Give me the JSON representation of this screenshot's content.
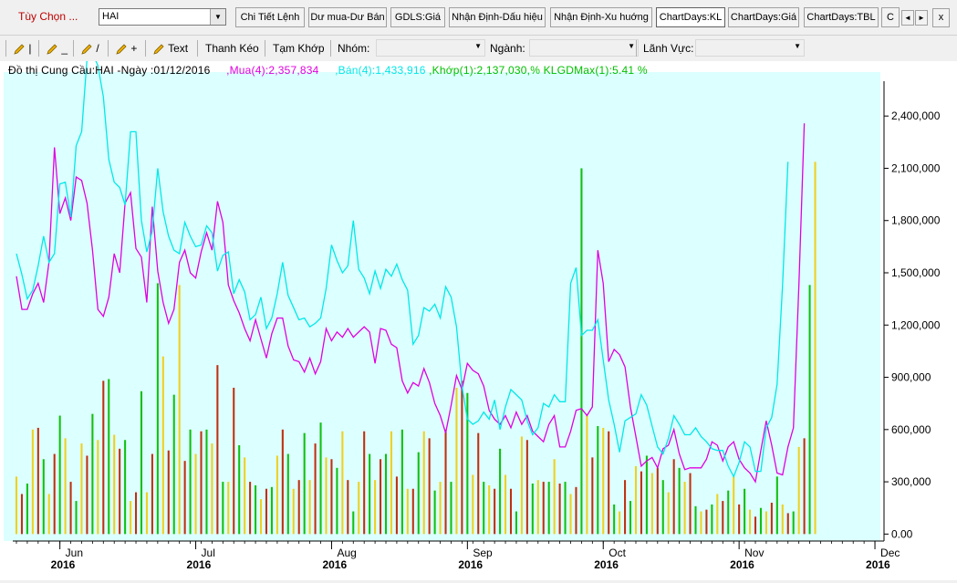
{
  "toolbar": {
    "options_label": "Tùy Chọn ...",
    "symbol": "HAI",
    "tabs": [
      {
        "label": "Chi Tiết Lệnh",
        "active": false
      },
      {
        "label": "Dư mua-Dư Bán",
        "active": false
      },
      {
        "label": "GDLS:Giá",
        "active": false
      },
      {
        "label": "Nhận Định-Dấu hiệu",
        "active": false
      },
      {
        "label": "Nhận Định-Xu huớng",
        "active": false
      },
      {
        "label": "ChartDays:KL",
        "active": true
      },
      {
        "label": "ChartDays:Giá",
        "active": false
      },
      {
        "label": "ChartDays:TBL",
        "active": false
      },
      {
        "label": "C",
        "active": false
      }
    ],
    "nav_prev": "◄",
    "nav_next": "►",
    "close": "x"
  },
  "drawbar": {
    "tools": [
      "|",
      "_",
      "/",
      "+",
      "Text"
    ],
    "drag_label": "Thanh Kéo",
    "pause_label": "Tạm Khớp",
    "group_label": "Nhóm:",
    "industry_label": "Ngành:",
    "field_label": "Lãnh Vực:"
  },
  "legend": {
    "title": "Đồ thị Cung Cầu:HAI -Ngày :01/12/2016",
    "buy": ",Mua(4):2,357,834",
    "sell": ",Bán(4):1,433,916",
    "match": ",Khớp(1):2,137,030,% KLGDMax(1):5.41 %",
    "colors": {
      "buy": "#e000e0",
      "sell": "#00e8e8",
      "match": "#00c000"
    }
  },
  "chart_data": {
    "type": "line",
    "ylim": [
      -40000,
      2600000
    ],
    "yticks": [
      0,
      300000,
      600000,
      900000,
      1200000,
      1500000,
      1800000,
      2100000,
      2400000
    ],
    "ytick_labels": [
      "0.00",
      "300,000",
      "600,000",
      "900,000",
      "1,200,000",
      "1,500,000",
      "1,800,000",
      "2,100,000",
      "2,400,000"
    ],
    "xticks": [
      {
        "day": 8,
        "month": "Jun",
        "year": "2016"
      },
      {
        "day": 33,
        "month": "Jul",
        "year": "2016"
      },
      {
        "day": 58,
        "month": "Aug",
        "year": "2016"
      },
      {
        "day": 83,
        "month": "Sep",
        "year": "2016"
      },
      {
        "day": 108,
        "month": "Oct",
        "year": "2016"
      },
      {
        "day": 133,
        "month": "Nov",
        "year": "2016"
      },
      {
        "day": 158,
        "month": "Dec",
        "year": "2016"
      }
    ],
    "x_count": 160,
    "series": [
      {
        "name": "Mua",
        "color": "#e000e0",
        "values": [
          1480000,
          1290000,
          1290000,
          1380000,
          1440000,
          1330000,
          1560000,
          2220000,
          1840000,
          1930000,
          1800000,
          2050000,
          2030000,
          1900000,
          1630000,
          1290000,
          1250000,
          1360000,
          1610000,
          1500000,
          1900000,
          1960000,
          1640000,
          1590000,
          1330000,
          1880000,
          1510000,
          1330000,
          1210000,
          1290000,
          1560000,
          1630000,
          1500000,
          1470000,
          1620000,
          1730000,
          1630000,
          1910000,
          1790000,
          1430000,
          1340000,
          1270000,
          1180000,
          1110000,
          1230000,
          1120000,
          1010000,
          1150000,
          1240000,
          1240000,
          1080000,
          1000000,
          990000,
          930000,
          1010000,
          920000,
          990000,
          1180000,
          1110000,
          1160000,
          1130000,
          1180000,
          1130000,
          1160000,
          1190000,
          1160000,
          980000,
          1180000,
          1170000,
          1090000,
          1070000,
          880000,
          810000,
          870000,
          850000,
          950000,
          870000,
          750000,
          680000,
          580000,
          740000,
          910000,
          830000,
          980000,
          940000,
          920000,
          850000,
          710000,
          660000,
          630000,
          680000,
          610000,
          700000,
          630000,
          680000,
          590000,
          560000,
          530000,
          630000,
          680000,
          500000,
          500000,
          590000,
          710000,
          720000,
          680000,
          730000,
          1630000,
          1440000,
          990000,
          1060000,
          1030000,
          960000,
          730000,
          560000,
          390000,
          420000,
          440000,
          380000,
          490000,
          510000,
          600000,
          460000,
          370000,
          380000,
          380000,
          380000,
          430000,
          530000,
          510000,
          420000,
          500000,
          530000,
          430000,
          380000,
          350000,
          300000,
          480000,
          650000,
          510000,
          350000,
          340000,
          500000,
          610000,
          1430000,
          2357834
        ]
      },
      {
        "name": "Bán",
        "color": "#00e8e8",
        "values": [
          1610000,
          1490000,
          1350000,
          1400000,
          1540000,
          1710000,
          1560000,
          1610000,
          2010000,
          2020000,
          1820000,
          2230000,
          2310000,
          2730000,
          2760000,
          2690000,
          2510000,
          2150000,
          2020000,
          1990000,
          1890000,
          2310000,
          2310000,
          1800000,
          1620000,
          1740000,
          2100000,
          1850000,
          1710000,
          1630000,
          1610000,
          1790000,
          1710000,
          1650000,
          1660000,
          1770000,
          1730000,
          1510000,
          1600000,
          1620000,
          1380000,
          1460000,
          1390000,
          1230000,
          1260000,
          1360000,
          1180000,
          1240000,
          1380000,
          1560000,
          1370000,
          1300000,
          1230000,
          1240000,
          1190000,
          1210000,
          1240000,
          1410000,
          1660000,
          1570000,
          1500000,
          1540000,
          1800000,
          1520000,
          1470000,
          1380000,
          1510000,
          1410000,
          1520000,
          1480000,
          1550000,
          1460000,
          1400000,
          1090000,
          1140000,
          1300000,
          1280000,
          1320000,
          1240000,
          1420000,
          1360000,
          1190000,
          850000,
          660000,
          630000,
          650000,
          700000,
          660000,
          770000,
          600000,
          730000,
          830000,
          800000,
          770000,
          650000,
          570000,
          610000,
          750000,
          730000,
          800000,
          760000,
          760000,
          1440000,
          1530000,
          1140000,
          1170000,
          1170000,
          1230000,
          1000000,
          770000,
          630000,
          470000,
          650000,
          670000,
          690000,
          800000,
          740000,
          620000,
          500000,
          460000,
          550000,
          680000,
          630000,
          570000,
          570000,
          610000,
          560000,
          530000,
          490000,
          480000,
          480000,
          390000,
          330000,
          410000,
          530000,
          500000,
          360000,
          360000,
          610000,
          670000,
          860000,
          1430000,
          2137030
        ]
      },
      {
        "name": "Khớp",
        "color": "#00c000",
        "values": []
      }
    ],
    "bars": [
      330000,
      230000,
      290000,
      600000,
      610000,
      430000,
      230000,
      460000,
      680000,
      550000,
      300000,
      190000,
      520000,
      450000,
      690000,
      540000,
      880000,
      890000,
      570000,
      490000,
      540000,
      190000,
      240000,
      820000,
      240000,
      460000,
      1440000,
      1020000,
      480000,
      800000,
      1430000,
      420000,
      600000,
      460000,
      590000,
      600000,
      520000,
      970000,
      300000,
      300000,
      840000,
      510000,
      440000,
      300000,
      280000,
      200000,
      260000,
      270000,
      450000,
      600000,
      460000,
      260000,
      310000,
      580000,
      310000,
      520000,
      640000,
      440000,
      430000,
      380000,
      590000,
      310000,
      130000,
      300000,
      590000,
      460000,
      310000,
      430000,
      460000,
      590000,
      330000,
      600000,
      260000,
      260000,
      470000,
      590000,
      550000,
      250000,
      300000,
      600000,
      300000,
      840000,
      880000,
      810000,
      340000,
      580000,
      300000,
      280000,
      260000,
      490000,
      340000,
      260000,
      130000,
      560000,
      540000,
      290000,
      310000,
      300000,
      300000,
      430000,
      290000,
      300000,
      230000,
      270000,
      2100000,
      690000,
      440000,
      620000,
      610000,
      590000,
      170000,
      130000,
      310000,
      190000,
      390000,
      360000,
      450000,
      350000,
      380000,
      310000,
      240000,
      430000,
      380000,
      300000,
      350000,
      160000,
      130000,
      140000,
      170000,
      230000,
      190000,
      250000,
      330000,
      170000,
      260000,
      140000,
      100000,
      150000,
      130000,
      180000,
      330000,
      170000,
      120000,
      130000,
      500000,
      550000,
      1430000,
      2137030
    ]
  }
}
